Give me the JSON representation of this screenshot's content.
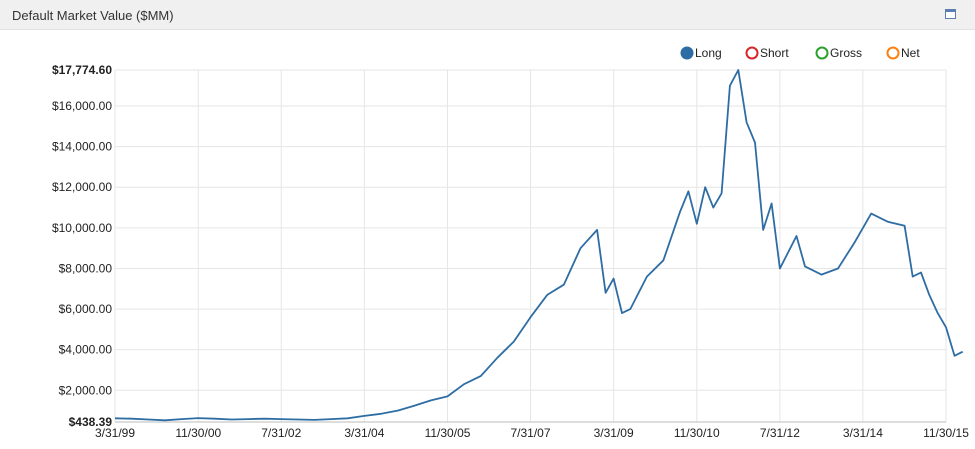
{
  "panel": {
    "title": "Default Market Value ($MM)"
  },
  "colors": {
    "long": "#2e6da4",
    "short": "#d62728",
    "gross": "#2ca02c",
    "net": "#ff7f0e",
    "grid": "#e6e6e6",
    "axis": "#666666"
  },
  "chart_data": {
    "type": "line",
    "title": "Default Market Value ($MM)",
    "xlabel": "",
    "ylabel": "",
    "x_ticks": [
      "3/31/99",
      "11/30/00",
      "7/31/02",
      "3/31/04",
      "11/30/05",
      "7/31/07",
      "3/31/09",
      "11/30/10",
      "7/31/12",
      "3/31/14",
      "11/30/15"
    ],
    "y_ticks": [
      "$438.39",
      "$2,000.00",
      "$4,000.00",
      "$6,000.00",
      "$8,000.00",
      "$10,000.00",
      "$12,000.00",
      "$14,000.00",
      "$16,000.00",
      "$17,774.60"
    ],
    "ylim": [
      438.39,
      17774.6
    ],
    "xlim": [
      "1999-03-31",
      "2015-11-30"
    ],
    "grid": true,
    "legend_position": "top-right",
    "legend": [
      {
        "name": "Long",
        "color": "#2e6da4",
        "active": true
      },
      {
        "name": "Short",
        "color": "#d62728",
        "active": false
      },
      {
        "name": "Gross",
        "color": "#2ca02c",
        "active": false
      },
      {
        "name": "Net",
        "color": "#ff7f0e",
        "active": false
      }
    ],
    "series": [
      {
        "name": "Long",
        "points": [
          [
            "1999-03-31",
            620
          ],
          [
            "1999-07-31",
            600
          ],
          [
            "1999-11-30",
            560
          ],
          [
            "2000-03-31",
            520
          ],
          [
            "2000-07-31",
            580
          ],
          [
            "2000-11-30",
            630
          ],
          [
            "2001-03-31",
            600
          ],
          [
            "2001-07-31",
            560
          ],
          [
            "2001-11-30",
            580
          ],
          [
            "2002-03-31",
            600
          ],
          [
            "2002-07-31",
            580
          ],
          [
            "2002-11-30",
            560
          ],
          [
            "2003-03-31",
            540
          ],
          [
            "2003-07-31",
            580
          ],
          [
            "2003-11-30",
            620
          ],
          [
            "2004-03-31",
            740
          ],
          [
            "2004-07-31",
            840
          ],
          [
            "2004-11-30",
            1000
          ],
          [
            "2005-03-31",
            1240
          ],
          [
            "2005-07-31",
            1500
          ],
          [
            "2005-11-30",
            1700
          ],
          [
            "2006-03-31",
            2300
          ],
          [
            "2006-07-31",
            2700
          ],
          [
            "2006-11-30",
            3600
          ],
          [
            "2007-03-31",
            4400
          ],
          [
            "2007-07-31",
            5600
          ],
          [
            "2007-11-30",
            6700
          ],
          [
            "2008-03-31",
            7200
          ],
          [
            "2008-07-31",
            9000
          ],
          [
            "2008-11-30",
            9900
          ],
          [
            "2009-01-31",
            6800
          ],
          [
            "2009-03-31",
            7500
          ],
          [
            "2009-05-31",
            5800
          ],
          [
            "2009-07-31",
            6000
          ],
          [
            "2009-11-30",
            7600
          ],
          [
            "2010-03-31",
            8400
          ],
          [
            "2010-07-31",
            10800
          ],
          [
            "2010-09-30",
            11800
          ],
          [
            "2010-11-30",
            10200
          ],
          [
            "2011-01-31",
            12000
          ],
          [
            "2011-03-31",
            11000
          ],
          [
            "2011-05-31",
            11700
          ],
          [
            "2011-07-31",
            17000
          ],
          [
            "2011-09-30",
            17774.6
          ],
          [
            "2011-11-30",
            15200
          ],
          [
            "2012-01-31",
            14200
          ],
          [
            "2012-03-31",
            9900
          ],
          [
            "2012-05-31",
            11200
          ],
          [
            "2012-07-31",
            8000
          ],
          [
            "2012-11-30",
            9600
          ],
          [
            "2013-01-31",
            8100
          ],
          [
            "2013-05-31",
            7700
          ],
          [
            "2013-09-30",
            8000
          ],
          [
            "2014-01-31",
            9300
          ],
          [
            "2014-05-31",
            10700
          ],
          [
            "2014-09-30",
            10300
          ],
          [
            "2015-01-31",
            10100
          ],
          [
            "2015-03-31",
            7600
          ],
          [
            "2015-05-31",
            7800
          ],
          [
            "2015-07-31",
            6700
          ],
          [
            "2015-09-30",
            5800
          ],
          [
            "2015-11-30",
            5100
          ],
          [
            "2016-01-31",
            3700
          ],
          [
            "2016-03-31",
            3900
          ]
        ]
      }
    ]
  }
}
